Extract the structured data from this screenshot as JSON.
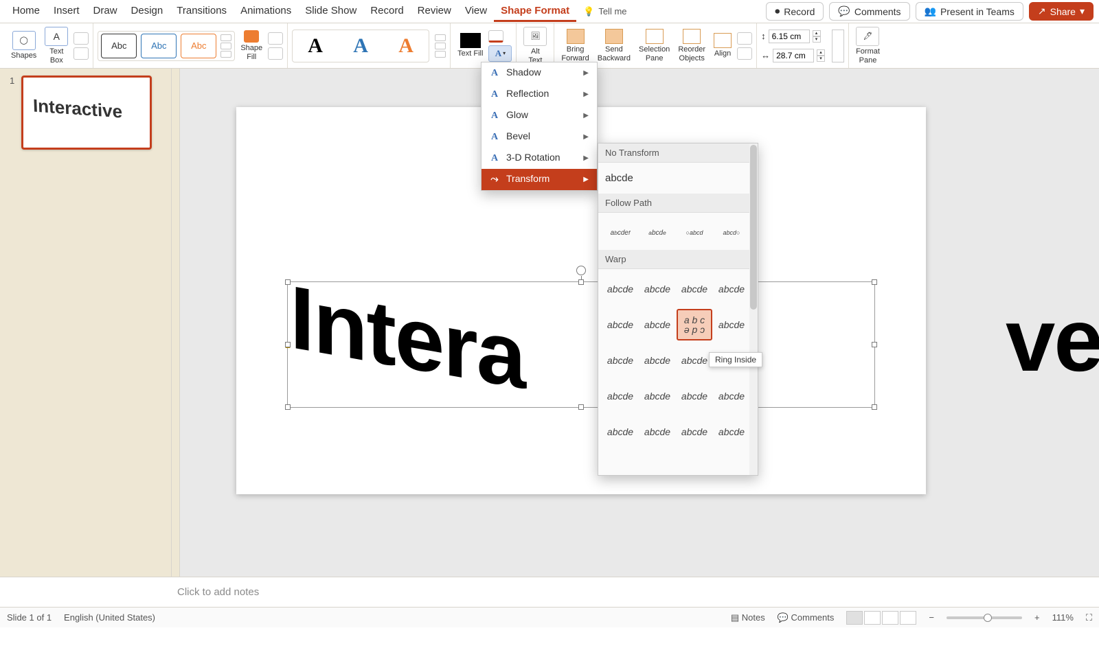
{
  "tabs": {
    "items": [
      "Home",
      "Insert",
      "Draw",
      "Design",
      "Transitions",
      "Animations",
      "Slide Show",
      "Record",
      "Review",
      "View",
      "Shape Format"
    ],
    "active": "Shape Format",
    "tellme": "Tell me"
  },
  "top_right": {
    "record": "Record",
    "comments": "Comments",
    "present": "Present in Teams",
    "share": "Share"
  },
  "ribbon": {
    "shapes": "Shapes",
    "textbox": "Text\nBox",
    "abc": "Abc",
    "shapeFill": "Shape\nFill",
    "bigA": "A",
    "textFill": "Text Fill",
    "altText": "Alt\nText",
    "bringForward": "Bring\nForward",
    "sendBackward": "Send\nBackward",
    "selectionPane": "Selection\nPane",
    "reorderObjects": "Reorder\nObjects",
    "align": "Align",
    "height": "6.15 cm",
    "width": "28.7 cm",
    "formatPane": "Format\nPane"
  },
  "fx_menu": {
    "items": [
      "Shadow",
      "Reflection",
      "Glow",
      "Bevel",
      "3-D Rotation",
      "Transform"
    ],
    "selected": "Transform"
  },
  "transform": {
    "no_header": "No Transform",
    "no_sample": "abcde",
    "follow_header": "Follow Path",
    "warp_header": "Warp",
    "cell": "abcde",
    "tooltip": "Ring Inside"
  },
  "thumb": {
    "num": "1",
    "text": "Interactive"
  },
  "slide": {
    "left_word": "Intera",
    "right_word": "ve"
  },
  "notes": {
    "placeholder": "Click to add notes"
  },
  "status": {
    "slide": "Slide 1 of 1",
    "lang": "English (United States)",
    "notes": "Notes",
    "comments": "Comments",
    "zoom": "111%"
  }
}
